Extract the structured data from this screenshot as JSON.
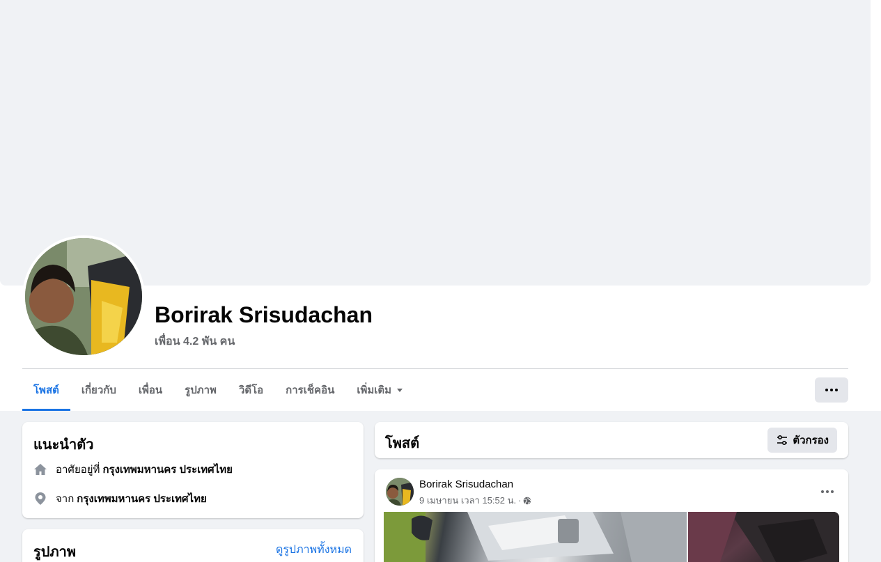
{
  "profile": {
    "name": "Borirak Srisudachan",
    "friends": "เพื่อน 4.2 พัน คน"
  },
  "tabs": [
    {
      "label": "โพสต์",
      "active": true
    },
    {
      "label": "เกี่ยวกับ",
      "active": false
    },
    {
      "label": "เพื่อน",
      "active": false
    },
    {
      "label": "รูปภาพ",
      "active": false
    },
    {
      "label": "วิดีโอ",
      "active": false
    },
    {
      "label": "การเช็คอิน",
      "active": false
    },
    {
      "label": "เพิ่มเติม",
      "active": false
    }
  ],
  "intro": {
    "title": "แนะนำตัว",
    "lives_prefix": "อาศัยอยู่ที่",
    "lives_place": "กรุงเทพมหานคร ประเทศไทย",
    "from_prefix": "จาก",
    "from_place": "กรุงเทพมหานคร ประเทศไทย"
  },
  "photos": {
    "title": "รูปภาพ",
    "see_all": "ดูรูปภาพทั้งหมด"
  },
  "posts": {
    "title": "โพสต์",
    "filter_label": "ตัวกรอง"
  },
  "post": {
    "author": "Borirak Srisudachan",
    "time": "9 เมษายน เวลา 15:52 น.",
    "separator": "·",
    "privacy_icon": "globe-icon"
  },
  "colors": {
    "accent": "#1b74e4",
    "background": "#f0f2f5",
    "secondary_text": "#65676b"
  }
}
